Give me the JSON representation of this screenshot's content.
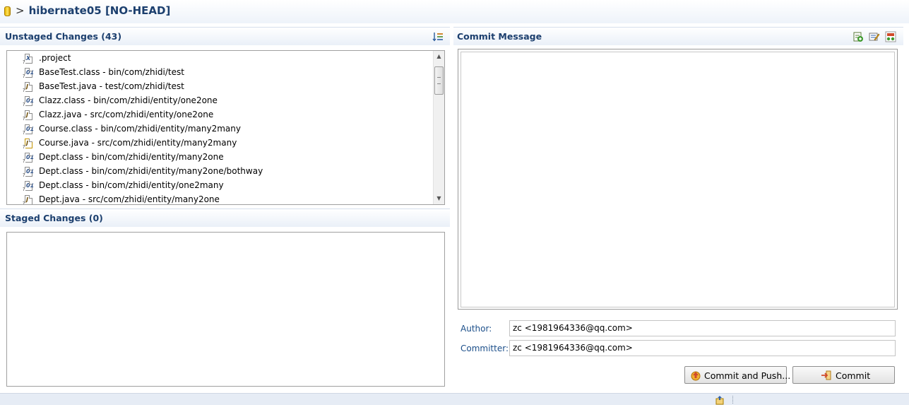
{
  "header": {
    "chevron": ">",
    "repo_label": "hibernate05 [NO-HEAD]"
  },
  "unstaged": {
    "title": "Unstaged Changes (43)",
    "files": [
      {
        "label": ".project",
        "icon": "xml-file-icon"
      },
      {
        "label": "BaseTest.class - bin/com/zhidi/test",
        "icon": "class-file-icon"
      },
      {
        "label": "BaseTest.java - test/com/zhidi/test",
        "icon": "java-file-icon"
      },
      {
        "label": "Clazz.class - bin/com/zhidi/entity/one2one",
        "icon": "class-file-icon"
      },
      {
        "label": "Clazz.java - src/com/zhidi/entity/one2one",
        "icon": "java-file-icon"
      },
      {
        "label": "Course.class - bin/com/zhidi/entity/many2many",
        "icon": "class-file-icon"
      },
      {
        "label": "Course.java - src/com/zhidi/entity/many2many",
        "icon": "java-file-warning-icon"
      },
      {
        "label": "Dept.class - bin/com/zhidi/entity/many2one",
        "icon": "class-file-icon"
      },
      {
        "label": "Dept.class - bin/com/zhidi/entity/many2one/bothway",
        "icon": "class-file-icon"
      },
      {
        "label": "Dept.class - bin/com/zhidi/entity/one2many",
        "icon": "class-file-icon"
      },
      {
        "label": "Dept.java - src/com/zhidi/entity/many2one",
        "icon": "java-file-icon"
      }
    ]
  },
  "staged": {
    "title": "Staged Changes (0)"
  },
  "commit": {
    "title": "Commit Message",
    "message": "",
    "author_label": "Author:",
    "author_value": "zc <1981964336@qq.com>",
    "committer_label": "Committer:",
    "committer_value": "zc <1981964336@qq.com>",
    "commit_push_label": "Commit and Push...",
    "commit_label": "Commit"
  },
  "colors": {
    "title_text": "#1c3f6e",
    "field_label": "#1c4f8a",
    "header_bg": "#eaf0f8"
  }
}
